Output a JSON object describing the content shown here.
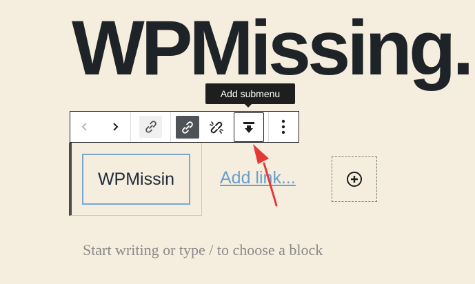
{
  "site": {
    "title": "WPMissing."
  },
  "tooltip": {
    "text": "Add submenu"
  },
  "toolbar": {
    "buttons": [
      {
        "name": "previous",
        "icon": "chevron-left-icon"
      },
      {
        "name": "next",
        "icon": "chevron-right-icon"
      },
      {
        "name": "link",
        "icon": "link-icon"
      },
      {
        "name": "link-active",
        "icon": "link-icon"
      },
      {
        "name": "unlink",
        "icon": "unlink-icon"
      },
      {
        "name": "add-submenu",
        "icon": "add-submenu-icon"
      },
      {
        "name": "more-options",
        "icon": "more-vertical-icon"
      }
    ]
  },
  "navigation": {
    "item_label": "WPMissin",
    "add_link_label": "Add link...",
    "appender_icon": "plus-circle-icon"
  },
  "editor": {
    "placeholder": "Start writing or type / to choose a block"
  },
  "colors": {
    "background": "#f5eddd",
    "accent": "#7aa7d2",
    "annotation": "#e53935"
  }
}
